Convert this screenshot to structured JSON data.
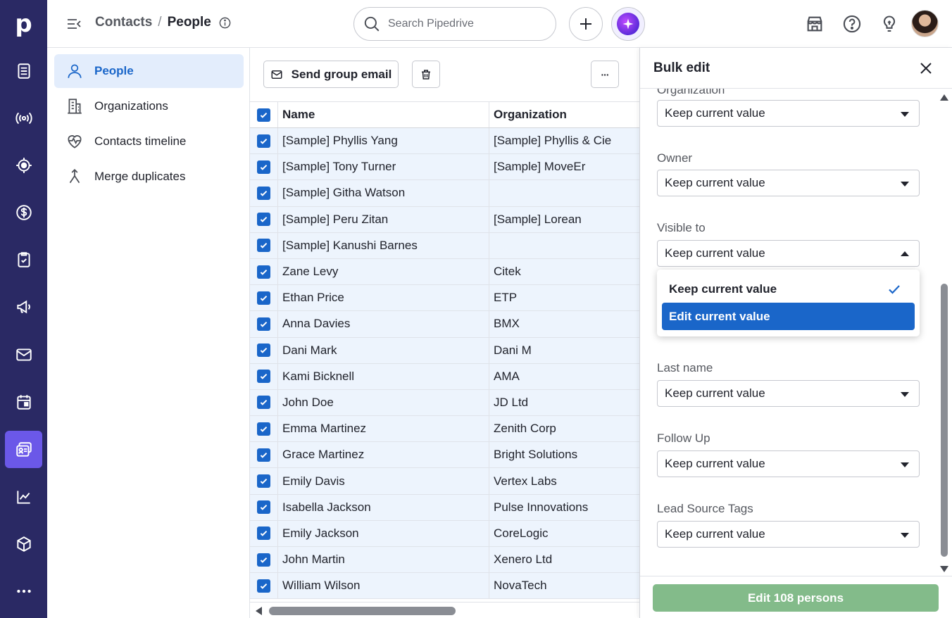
{
  "rail": {
    "logo": "p",
    "items": [
      {
        "name": "leads-inbox-icon"
      },
      {
        "name": "broadcast-icon"
      },
      {
        "name": "target-icon"
      },
      {
        "name": "dollar-icon"
      },
      {
        "name": "clipboard-check-icon"
      },
      {
        "name": "megaphone-icon"
      },
      {
        "name": "mail-icon"
      },
      {
        "name": "calendar-icon"
      },
      {
        "name": "contacts-card-icon"
      },
      {
        "name": "chart-icon"
      },
      {
        "name": "box-icon"
      },
      {
        "name": "more-icon"
      }
    ],
    "active_index": 8,
    "colors": {
      "background": "#2a2964",
      "active": "#6b58e8"
    }
  },
  "header": {
    "breadcrumb_parent": "Contacts",
    "breadcrumb_sep": "/",
    "breadcrumb_current": "People",
    "search_placeholder": "Search Pipedrive"
  },
  "sidebar": {
    "items": [
      {
        "label": "People",
        "icon": "person-icon",
        "active": true
      },
      {
        "label": "Organizations",
        "icon": "building-icon",
        "active": false
      },
      {
        "label": "Contacts timeline",
        "icon": "heart-pulse-icon",
        "active": false
      },
      {
        "label": "Merge duplicates",
        "icon": "merge-icon",
        "active": false
      }
    ]
  },
  "toolbar": {
    "send_group_email": "Send group email",
    "more": "···"
  },
  "table": {
    "columns": [
      "Name",
      "Organization"
    ],
    "rows": [
      {
        "name": "[Sample] Phyllis Yang",
        "org": "[Sample] Phyllis & Cie"
      },
      {
        "name": "[Sample] Tony Turner",
        "org": "[Sample] MoveEr"
      },
      {
        "name": "[Sample] Githa Watson",
        "org": ""
      },
      {
        "name": "[Sample] Peru Zitan",
        "org": "[Sample] Lorean"
      },
      {
        "name": "[Sample] Kanushi Barnes",
        "org": ""
      },
      {
        "name": "Zane Levy",
        "org": "Citek"
      },
      {
        "name": "Ethan Price",
        "org": "ETP"
      },
      {
        "name": "Anna Davies",
        "org": "BMX"
      },
      {
        "name": "Dani Mark",
        "org": "Dani M"
      },
      {
        "name": "Kami Bicknell",
        "org": "AMA"
      },
      {
        "name": "John Doe",
        "org": "JD Ltd"
      },
      {
        "name": "Emma Martinez",
        "org": "Zenith Corp"
      },
      {
        "name": "Grace Martinez",
        "org": "Bright Solutions"
      },
      {
        "name": "Emily Davis",
        "org": "Vertex Labs"
      },
      {
        "name": "Isabella Jackson",
        "org": "Pulse Innovations"
      },
      {
        "name": "Emily Jackson",
        "org": "CoreLogic"
      },
      {
        "name": "John Martin",
        "org": "Xenero Ltd"
      },
      {
        "name": "William Wilson",
        "org": "NovaTech"
      }
    ]
  },
  "bulk_edit": {
    "title": "Bulk edit",
    "fields": [
      {
        "label": "Organization",
        "value": "Keep current value"
      },
      {
        "label": "Owner",
        "value": "Keep current value"
      },
      {
        "label": "Visible to",
        "value": "Keep current value",
        "open": true
      },
      {
        "label": "Last name",
        "value": "Keep current value"
      },
      {
        "label": "Follow Up",
        "value": "Keep current value"
      },
      {
        "label": "Lead Source Tags",
        "value": "Keep current value"
      }
    ],
    "dropdown_options": [
      {
        "label": "Keep current value",
        "selected": true
      },
      {
        "label": "Edit current value",
        "highlighted": true
      }
    ],
    "submit_label": "Edit 108 persons",
    "colors": {
      "accent": "#1a66c9",
      "submit": "#83bb8a"
    }
  }
}
